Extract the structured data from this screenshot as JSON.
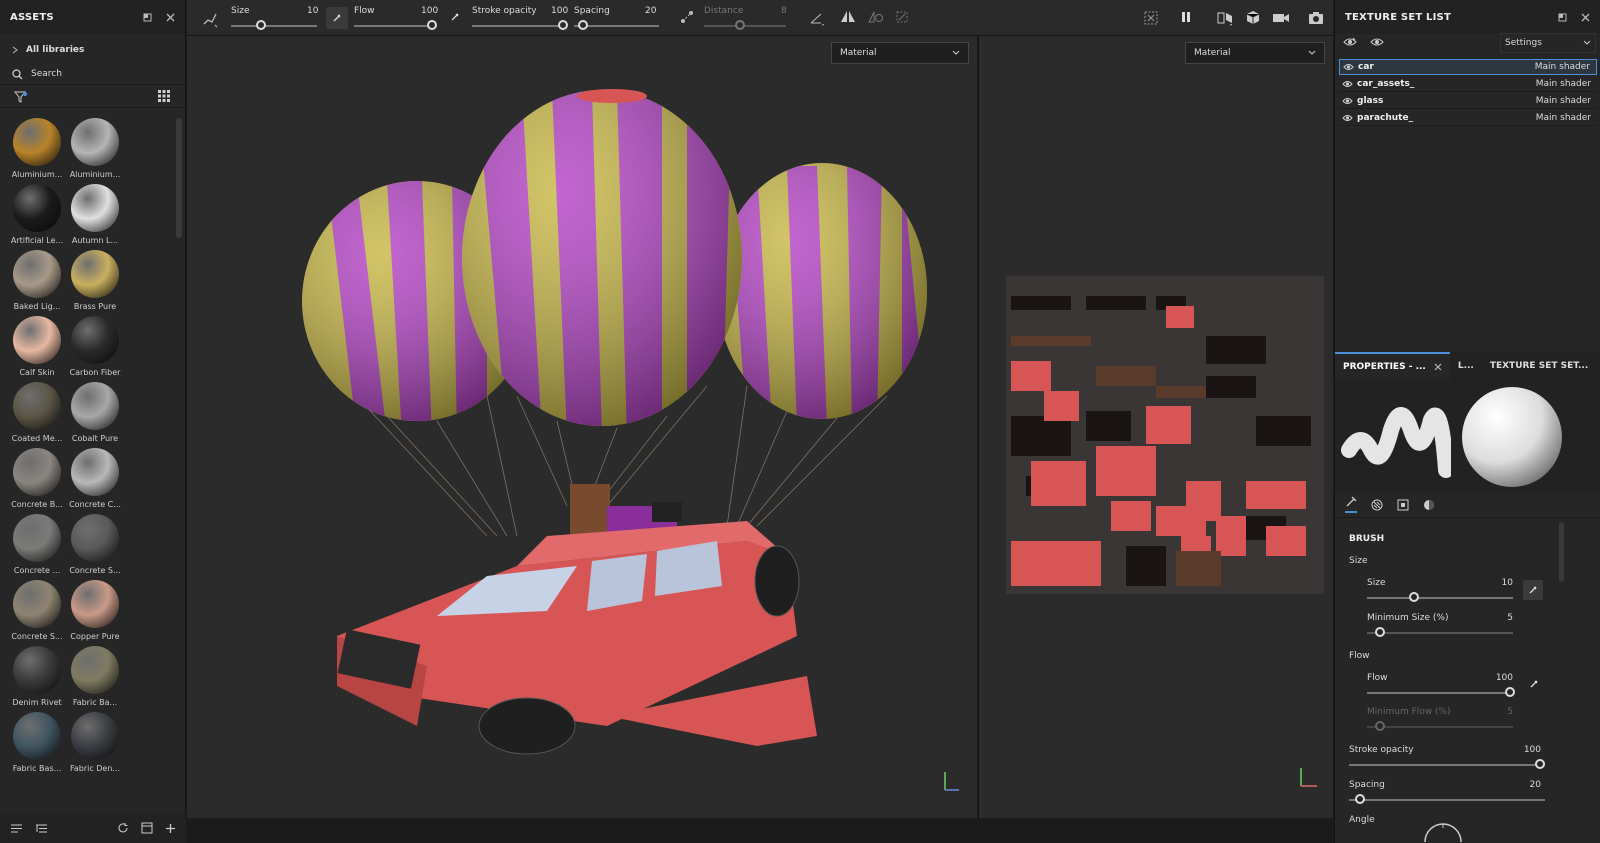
{
  "assets": {
    "title": "ASSETS",
    "library": "All libraries",
    "search_placeholder": "Search",
    "materials": [
      {
        "label": "Aluminium...",
        "color": "#b8832a"
      },
      {
        "label": "Aluminium...",
        "color": "#b5b5b5"
      },
      {
        "label": "Artificial Le...",
        "color": "#1b1b1b"
      },
      {
        "label": "Autumn L...",
        "color": "#e0e0e0"
      },
      {
        "label": "Baked Lig...",
        "color": "#a89a88"
      },
      {
        "label": "Brass Pure",
        "color": "#c9b060"
      },
      {
        "label": "Calf Skin",
        "color": "#e6b8a2"
      },
      {
        "label": "Carbon Fiber",
        "color": "#2a2a2a"
      },
      {
        "label": "Coated Me...",
        "color": "#5a5545"
      },
      {
        "label": "Cobalt Pure",
        "color": "#a8a8a8"
      },
      {
        "label": "Concrete B...",
        "color": "#8a8580"
      },
      {
        "label": "Concrete C...",
        "color": "#b8b8b8"
      },
      {
        "label": "Concrete ...",
        "color": "#7a7a78"
      },
      {
        "label": "Concrete S...",
        "color": "#5a5a5a"
      },
      {
        "label": "Concrete S...",
        "color": "#8f8472"
      },
      {
        "label": "Copper Pure",
        "color": "#c99a88"
      },
      {
        "label": "Denim Rivet",
        "color": "#3a3a3a"
      },
      {
        "label": "Fabric Ba...",
        "color": "#7f7b62"
      },
      {
        "label": "Fabric Bas...",
        "color": "#3f5560"
      },
      {
        "label": "Fabric Den...",
        "color": "#3a3d42"
      }
    ]
  },
  "toolbar": {
    "size_label": "Size",
    "size_value": "10",
    "flow_label": "Flow",
    "flow_value": "100",
    "stroke_label": "Stroke opacity",
    "stroke_value": "100",
    "spacing_label": "Spacing",
    "spacing_value": "20",
    "distance_label": "Distance",
    "distance_value": "8"
  },
  "viewport": {
    "dropdown_3d": "Material",
    "dropdown_2d": "Material"
  },
  "texture_set_list": {
    "title": "TEXTURE SET LIST",
    "settings": "Settings",
    "items": [
      {
        "name": "car",
        "shader": "Main shader"
      },
      {
        "name": "car_assets_",
        "shader": "Main shader"
      },
      {
        "name": "glass",
        "shader": "Main shader"
      },
      {
        "name": "parachute_",
        "shader": "Main shader"
      }
    ]
  },
  "properties": {
    "tab1": "PROPERTIES - ...",
    "tab2": "L...",
    "tab3": "TEXTURE SET SET...",
    "section": "BRUSH",
    "size_group": "Size",
    "size_label": "Size",
    "size_value": "10",
    "min_size_label": "Minimum Size (%)",
    "min_size_value": "5",
    "flow_group": "Flow",
    "flow_label": "Flow",
    "flow_value": "100",
    "min_flow_label": "Minimum Flow (%)",
    "min_flow_value": "5",
    "stroke_label": "Stroke opacity",
    "stroke_value": "100",
    "spacing_label": "Spacing",
    "spacing_value": "20",
    "angle_label": "Angle"
  },
  "colors": {
    "accent": "#4a90d9",
    "balloon_purple": "#b23ec4",
    "balloon_yellow": "#c7b540",
    "car_red": "#d85555"
  }
}
